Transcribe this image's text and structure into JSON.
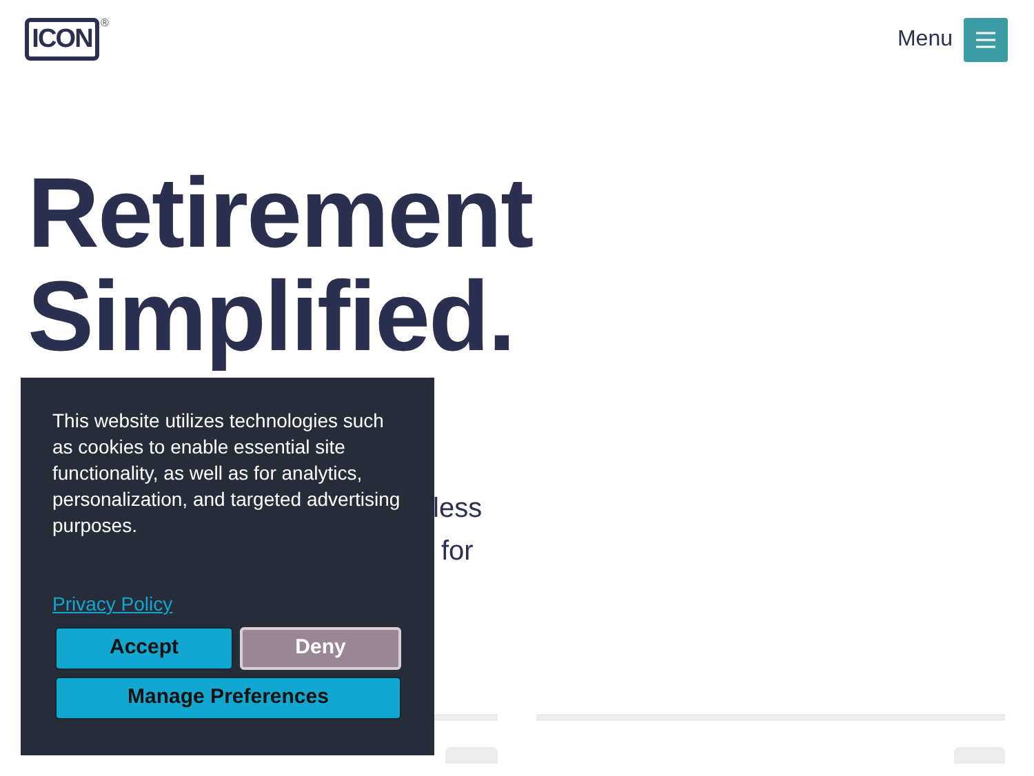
{
  "header": {
    "logo": "ICON",
    "registered": "®",
    "menu_label": "Menu"
  },
  "hero": {
    "title_lines": [
      "Retirement",
      "Simplified."
    ],
    "visible_text": [
      "less",
      "for"
    ]
  },
  "cookie_banner": {
    "message": "This website utilizes technologies such as cookies to enable essential site functionality, as well as for analytics, personalization, and targeted advertising purposes.",
    "privacy_link": "Privacy Policy",
    "buttons": [
      {
        "label": "Accept",
        "kind": "primary"
      },
      {
        "label": "Deny",
        "kind": "secondary"
      },
      {
        "label": "Manage Preferences",
        "kind": "primary"
      }
    ]
  }
}
